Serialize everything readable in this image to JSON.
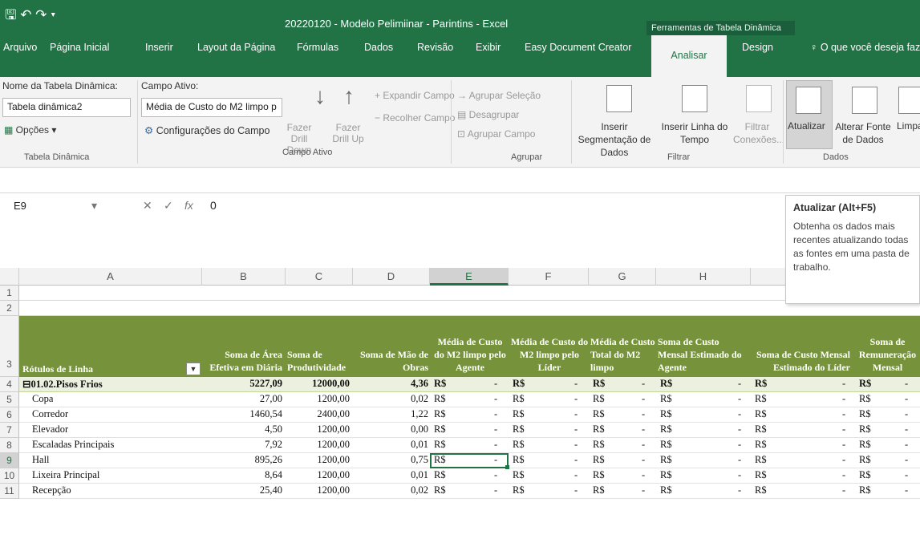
{
  "window": {
    "title": "20220120 - Modelo Pelimiinar - Parintins - Excel",
    "qat": "🖫 ↶ ↷ ▾"
  },
  "context_header": "Ferramentas de Tabela Dinâmica",
  "tabs": [
    "Arquivo",
    "Página Inicial",
    "Inserir",
    "Layout da Página",
    "Fórmulas",
    "Dados",
    "Revisão",
    "Exibir",
    "Easy Document Creator",
    "Analisar",
    "Design"
  ],
  "tell_me": "O que você deseja fazer...",
  "ribbon": {
    "pivot_name_label": "Nome da Tabela Dinâmica:",
    "pivot_name_value": "Tabela dinâmica2",
    "options_label": "Opções",
    "group_pivot": "Tabela Dinâmica",
    "active_field_label": "Campo Ativo:",
    "active_field_value": "Média de Custo do M2 limpo p",
    "field_settings": "Configurações do Campo",
    "drill_down": "Fazer Drill Down",
    "drill_up": "Fazer Drill Up",
    "expand_field": "Expandir Campo",
    "collapse_field": "Recolher Campo",
    "group_active_field": "Campo Ativo",
    "group_selection": "Agrupar Seleção",
    "ungroup": "Desagrupar",
    "group_field": "Agrupar Campo",
    "group_group": "Agrupar",
    "insert_slicer": "Inserir Segmentação de Dados",
    "insert_timeline": "Inserir Linha do Tempo",
    "filter_connections": "Filtrar Conexões...",
    "group_filter": "Filtrar",
    "refresh": "Atualizar",
    "change_source": "Alterar Fonte de Dados",
    "group_data": "Dados",
    "clear": "Limpa"
  },
  "formula_bar": {
    "name_box": "E9",
    "value": "0"
  },
  "tooltip": {
    "title": "Atualizar (Alt+F5)",
    "body": "Obtenha os dados mais recentes atualizando todas as fontes em uma pasta de trabalho."
  },
  "columns": [
    "A",
    "B",
    "C",
    "D",
    "E",
    "F",
    "G",
    "H"
  ],
  "rows": [
    "1",
    "2",
    "3",
    "4",
    "5",
    "6",
    "7",
    "8",
    "9",
    "10",
    "11"
  ],
  "table": {
    "headers": [
      "Rótulos de Linha",
      "Soma de Área Efetiva em Diária",
      "Soma de Produtividade",
      "Soma de Mão de Obras",
      "Média de Custo do M2 limpo pelo Agente",
      "Média de Custo do M2 limpo pelo Líder",
      "Média de Custo Total do M2 limpo",
      "Soma de Custo Mensal Estimado do Agente",
      "Soma de Custo Mensal Estimado do Líder",
      "Soma de Remuneração Mensal"
    ],
    "group_row": {
      "label": "01.02.Pisos Frios",
      "area": "5227,09",
      "prod": "12000,00",
      "mao": "4,36"
    },
    "currency": "R$",
    "dash": "-",
    "items": [
      {
        "label": "Copa",
        "area": "27,00",
        "prod": "1200,00",
        "mao": "0,02"
      },
      {
        "label": "Corredor",
        "area": "1460,54",
        "prod": "2400,00",
        "mao": "1,22"
      },
      {
        "label": "Elevador",
        "area": "4,50",
        "prod": "1200,00",
        "mao": "0,00"
      },
      {
        "label": "Escaladas Principais",
        "area": "7,92",
        "prod": "1200,00",
        "mao": "0,01"
      },
      {
        "label": "Hall",
        "area": "895,26",
        "prod": "1200,00",
        "mao": "0,75"
      },
      {
        "label": "Lixeira Principal",
        "area": "8,64",
        "prod": "1200,00",
        "mao": "0,01"
      },
      {
        "label": "Recepção",
        "area": "25,40",
        "prod": "1200,00",
        "mao": "0,02"
      }
    ]
  },
  "colors": {
    "excel_green": "#217346",
    "pivot_header": "#76933c",
    "pivot_group_row": "#ebf1de"
  }
}
